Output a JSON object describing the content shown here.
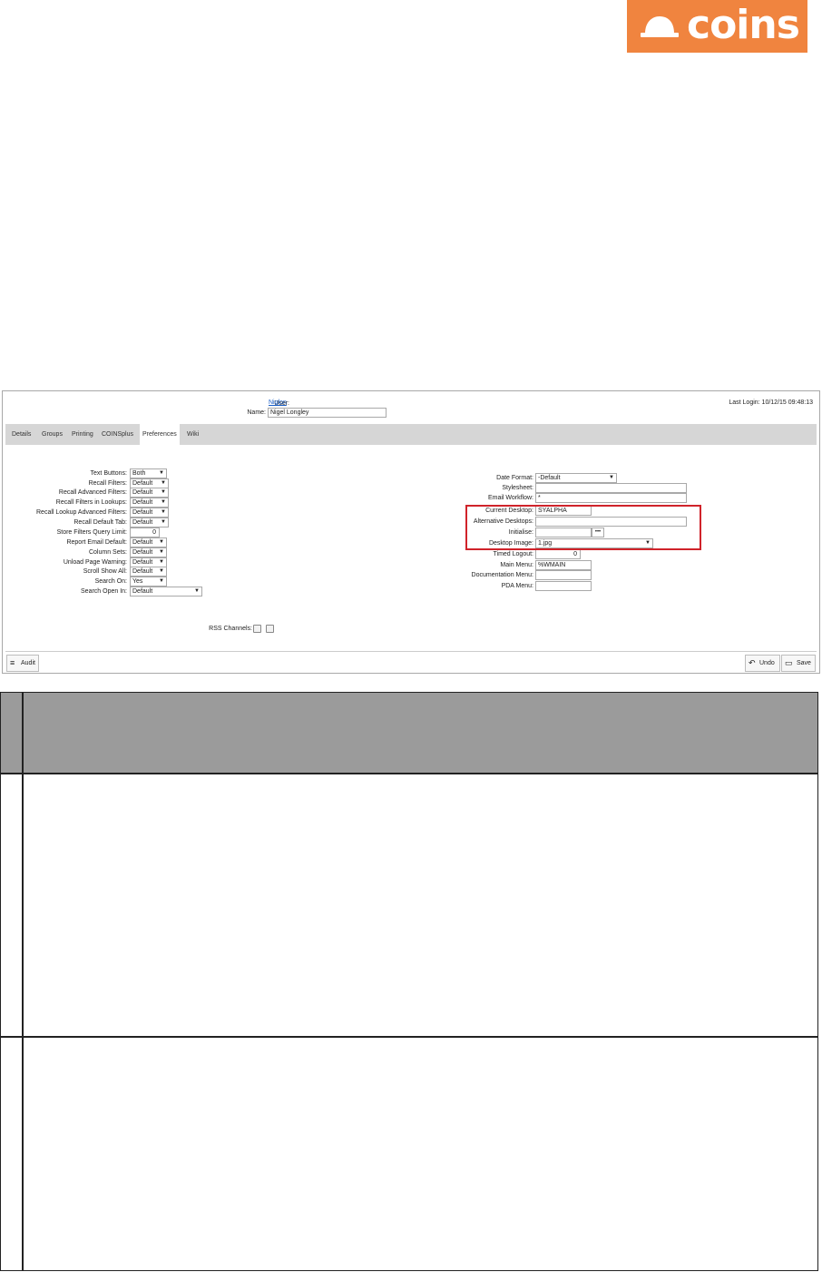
{
  "logo": {
    "text": "coins"
  },
  "header": {
    "user_label": "User:",
    "user_value": "Niglon",
    "name_label": "Name:",
    "name_value": "Nigel Longley",
    "last_login": "Last Login: 10/12/15 09:48:13"
  },
  "tabs": [
    "Details",
    "Groups",
    "Printing",
    "COINSplus",
    "Preferences",
    "Wiki"
  ],
  "active_tab": "Preferences",
  "left_fields": [
    {
      "label": "Text Buttons:",
      "value": "Both"
    },
    {
      "label": "Recall Filters:",
      "value": "Default"
    },
    {
      "label": "Recall Advanced Filters:",
      "value": "Default"
    },
    {
      "label": "Recall Filters in Lookups:",
      "value": "Default"
    },
    {
      "label": "Recall Lookup Advanced Filters:",
      "value": "Default"
    },
    {
      "label": "Recall Default Tab:",
      "value": "Default"
    },
    {
      "label": "Store Filters Query Limit:",
      "value": "0"
    },
    {
      "label": "Report Email Default:",
      "value": "Default"
    },
    {
      "label": "Column Sets:",
      "value": "Default"
    },
    {
      "label": "Unload Page Warning:",
      "value": "Default"
    },
    {
      "label": "Scroll Show All:",
      "value": "Default"
    },
    {
      "label": "Search On:",
      "value": "Yes"
    },
    {
      "label": "Search Open In:",
      "value": "Default"
    }
  ],
  "rss": {
    "label": "RSS Channels:"
  },
  "right_fields": [
    {
      "label": "Date Format:",
      "value": "-Default"
    },
    {
      "label": "Stylesheet:",
      "value": ""
    },
    {
      "label": "Email Workflow:",
      "value": "*"
    },
    {
      "label": "Current Desktop:",
      "value": "SYALPHA"
    },
    {
      "label": "Alternative Desktops:",
      "value": ""
    },
    {
      "label": "Initialise:",
      "value": ""
    },
    {
      "label": "Desktop Image:",
      "value": "1.jpg"
    },
    {
      "label": "Timed Logout:",
      "value": "0"
    },
    {
      "label": "Main Menu:",
      "value": "%WMAIN"
    },
    {
      "label": "Documentation Menu:",
      "value": ""
    },
    {
      "label": "PDA Menu:",
      "value": ""
    }
  ],
  "initialise_button": "•••",
  "footer": {
    "audit": "Audit",
    "undo": "Undo",
    "save": "Save"
  },
  "colors": {
    "brand": "#f0843f",
    "highlight": "#d0232a",
    "table_header": "#9b9b9b"
  }
}
